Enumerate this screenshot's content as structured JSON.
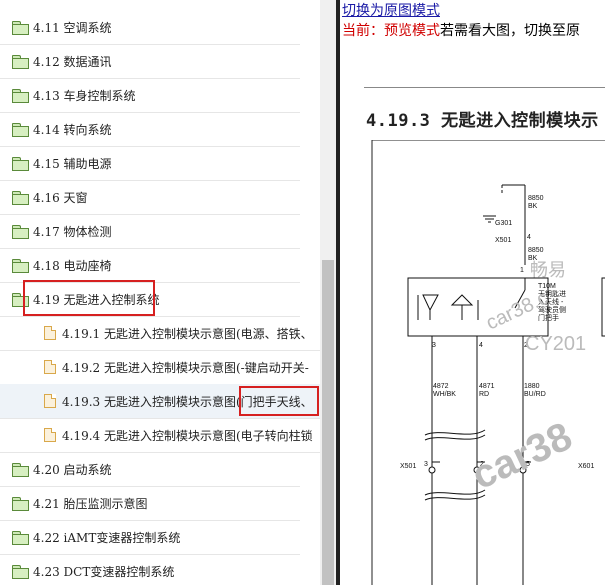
{
  "tree": {
    "items": [
      {
        "label": "4.11 空调系统",
        "type": "folder"
      },
      {
        "label": "4.12 数据通讯",
        "type": "folder"
      },
      {
        "label": "4.13 车身控制系统",
        "type": "folder"
      },
      {
        "label": "4.14 转向系统",
        "type": "folder"
      },
      {
        "label": "4.15 辅助电源",
        "type": "folder"
      },
      {
        "label": "4.16 天窗",
        "type": "folder"
      },
      {
        "label": "4.17 物体检测",
        "type": "folder"
      },
      {
        "label": "4.18 电动座椅",
        "type": "folder"
      },
      {
        "label": "4.19 无匙进入控制系统",
        "type": "folder"
      },
      {
        "label": "4.19.1 无匙进入控制模块示意图(电源、搭铁、",
        "type": "doc"
      },
      {
        "label": "4.19.2 无匙进入控制模块示意图(-键启动开关-",
        "type": "doc"
      },
      {
        "label": "4.19.3 无匙进入控制模块示意图(门把手天线、",
        "type": "doc"
      },
      {
        "label": "4.19.4 无匙进入控制模块示意图(电子转向柱锁",
        "type": "doc"
      },
      {
        "label": "4.20 启动系统",
        "type": "folder"
      },
      {
        "label": "4.21 胎压监测示意图",
        "type": "folder"
      },
      {
        "label": "4.22 iAMT变速器控制系统",
        "type": "folder"
      },
      {
        "label": "4.23 DCT变速器控制系统",
        "type": "folder"
      }
    ]
  },
  "main": {
    "switch_link": "切换为原图模式",
    "status_prefix": "当前：",
    "status_mode": "预览模式",
    "status_suffix": "若需看大图，切换至原",
    "doc_title": "4.19.3 无匙进入控制模块示"
  },
  "diagram": {
    "top_wire_num": "8850",
    "top_wire_color": "BK",
    "ground_label": "G301",
    "connector_top": "X501",
    "pin_top": "4",
    "mid_wire_num": "8850",
    "mid_wire_color": "BK",
    "pin_1": "1",
    "module_code": "T10M",
    "module_lines": [
      "无钥匙进",
      "入天线 -",
      "驾驶员侧",
      "门把手"
    ],
    "pin_3": "3",
    "pin_4": "4",
    "pin_2": "2",
    "wire_a_num": "4872",
    "wire_a_color": "WH/BK",
    "wire_b_num": "4871",
    "wire_b_color": "RD",
    "wire_c_num": "1880",
    "wire_c_color": "BU/RD",
    "connector_bottom": "X501",
    "connector_bottom_right": "X601",
    "pin_b3": "3",
    "pin_b2": "2",
    "pin_b5": "5"
  },
  "watermark": {
    "text_large": "car38",
    "text_small": "car38.c",
    "text_cn": "畅易",
    "text_year": "CY201"
  },
  "colors": {
    "highlight": "#d62020",
    "link": "#1a1aa6",
    "status_red": "#d00000"
  }
}
